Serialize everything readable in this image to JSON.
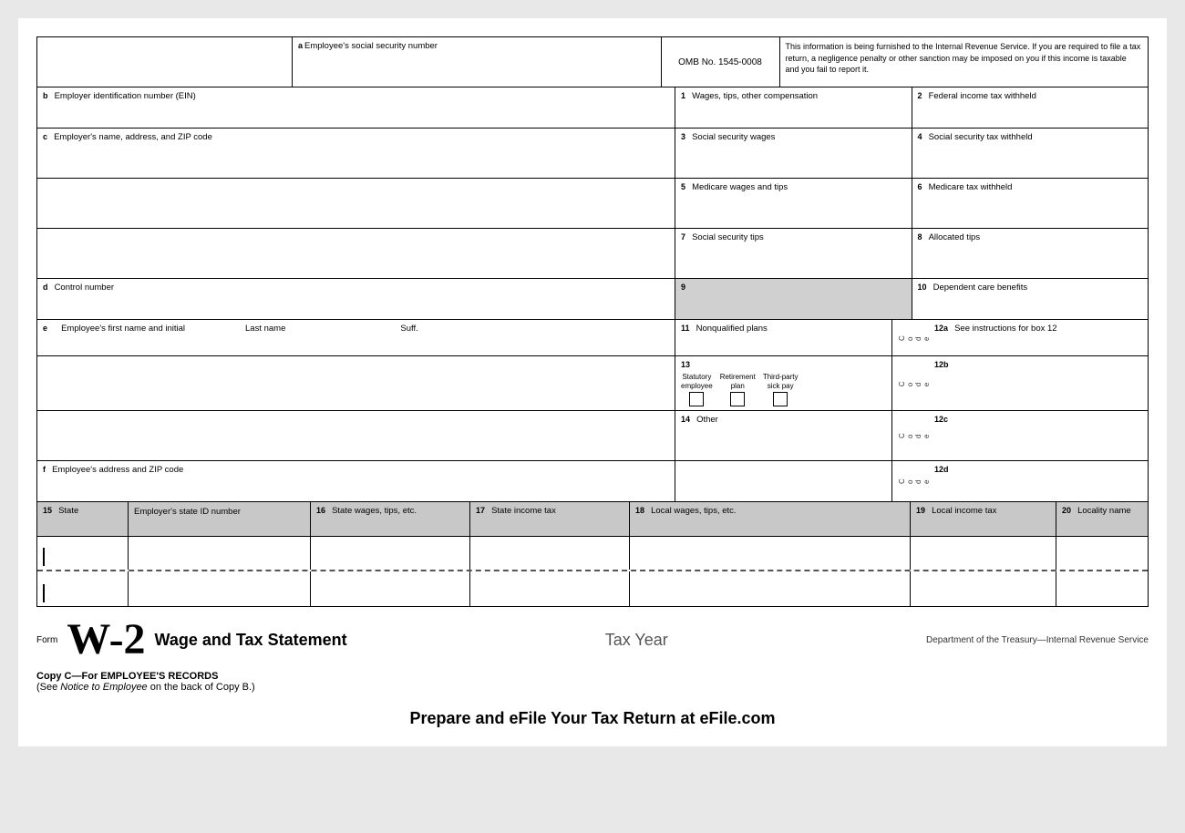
{
  "form": {
    "title": "W-2",
    "form_label": "Form",
    "subtitle": "Wage and Tax Statement",
    "tax_year_label": "Tax Year",
    "dept_label": "Department of the Treasury—Internal Revenue Service",
    "copy_c_bold": "Copy C—For EMPLOYEE'S RECORDS",
    "copy_c_note": "(See ",
    "copy_c_italic": "Notice to Employee",
    "copy_c_end": " on the back of Copy B.)",
    "prepare_banner": "Prepare and eFile Your Tax Return at eFile.com",
    "omb": "OMB No. 1545-0008",
    "info_text": "This information is being furnished to the Internal Revenue Service. If you are required to file a tax return, a negligence penalty or other sanction may be imposed on you if this income is taxable and you fail to report it."
  },
  "fields": {
    "a_label": "a",
    "a_text": "Employee's social security number",
    "b_label": "b",
    "b_text": "Employer identification number (EIN)",
    "c_label": "c",
    "c_text": "Employer's name, address, and ZIP code",
    "d_label": "d",
    "d_text": "Control number",
    "e_label": "e",
    "e_first": "Employee's first name and initial",
    "e_last": "Last name",
    "e_suff": "Suff.",
    "f_label": "f",
    "f_text": "Employee's address and ZIP code",
    "box1_num": "1",
    "box1_text": "Wages, tips, other compensation",
    "box2_num": "2",
    "box2_text": "Federal income tax withheld",
    "box3_num": "3",
    "box3_text": "Social security wages",
    "box4_num": "4",
    "box4_text": "Social security tax withheld",
    "box5_num": "5",
    "box5_text": "Medicare wages and tips",
    "box6_num": "6",
    "box6_text": "Medicare tax withheld",
    "box7_num": "7",
    "box7_text": "Social security tips",
    "box8_num": "8",
    "box8_text": "Allocated tips",
    "box9_num": "9",
    "box10_num": "10",
    "box10_text": "Dependent care benefits",
    "box11_num": "11",
    "box11_text": "Nonqualified plans",
    "box12a_num": "12a",
    "box12a_text": "See instructions for box 12",
    "box12a_code": "C\no\nd\ne",
    "box12b_num": "12b",
    "box12b_code": "C\no\nd\ne",
    "box12c_num": "12c",
    "box12c_code": "C\no\nd\ne",
    "box12d_num": "12d",
    "box12d_code": "C\no\nd\ne",
    "box13_num": "13",
    "box13_statutory": "Statutory\nemployee",
    "box13_retirement": "Retirement\nplan",
    "box13_thirdparty": "Third-party\nsick pay",
    "box14_num": "14",
    "box14_text": "Other",
    "box15_num": "15",
    "box15_text": "State",
    "box15b_text": "Employer's state ID number",
    "box16_num": "16",
    "box16_text": "State wages, tips, etc.",
    "box17_num": "17",
    "box17_text": "State income tax",
    "box18_num": "18",
    "box18_text": "Local wages, tips, etc.",
    "box19_num": "19",
    "box19_text": "Local income tax",
    "box20_num": "20",
    "box20_text": "Locality name"
  }
}
